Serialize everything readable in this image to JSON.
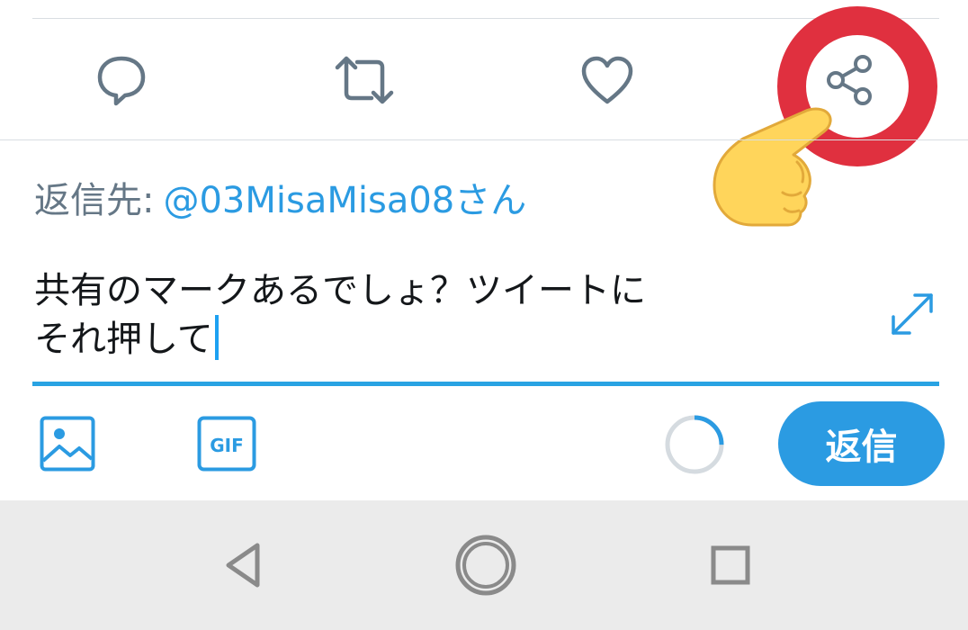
{
  "colors": {
    "accent": "#2b9be2",
    "icon_gray": "#657786",
    "highlight_red": "#e0303f",
    "hand_yellow": "#ffd55b"
  },
  "action_bar": {
    "icons": [
      "reply-icon",
      "retweet-icon",
      "like-icon",
      "share-icon"
    ]
  },
  "reply_to": {
    "label": "返信先:",
    "handle": "@03MisaMisa08さん"
  },
  "compose": {
    "line1": "共有のマークあるでしょ？ツイートに",
    "line2": "それ押して"
  },
  "toolbar": {
    "image_icon": "image-icon",
    "gif_label": "GIF",
    "char_progress": 0.25,
    "reply_button_label": "返信"
  },
  "nav_bar": {
    "icons": [
      "back-icon",
      "home-icon",
      "recents-icon"
    ]
  }
}
